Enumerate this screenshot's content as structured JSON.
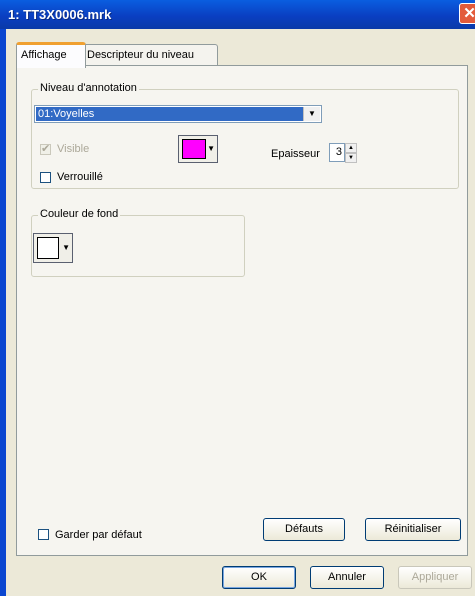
{
  "window": {
    "title": "1: TT3X0006.mrk",
    "close_glyph": "✕"
  },
  "tabs": [
    {
      "label": "Affichage",
      "active": true
    },
    {
      "label": "Descripteur du niveau",
      "active": false
    }
  ],
  "annotation_group": {
    "legend": "Niveau d'annotation",
    "level_select": {
      "value": "01:Voyelles"
    },
    "visible": {
      "label": "Visible",
      "checked": true,
      "enabled": false
    },
    "locked": {
      "label": "Verrouillé",
      "checked": false
    },
    "line_color": "#ff00ff",
    "thickness": {
      "label": "Epaisseur",
      "value": "3"
    }
  },
  "background_group": {
    "legend": "Couleur de fond",
    "color": "#ffffff"
  },
  "keep_default": {
    "label": "Garder par défaut",
    "checked": false
  },
  "buttons": {
    "defaults": "Défauts",
    "reset": "Réinitialiser",
    "ok": "OK",
    "cancel": "Annuler",
    "apply": "Appliquer"
  },
  "icons": {
    "dropdown": "▼",
    "spin_up": "▲",
    "spin_down": "▼",
    "check": "✔"
  }
}
